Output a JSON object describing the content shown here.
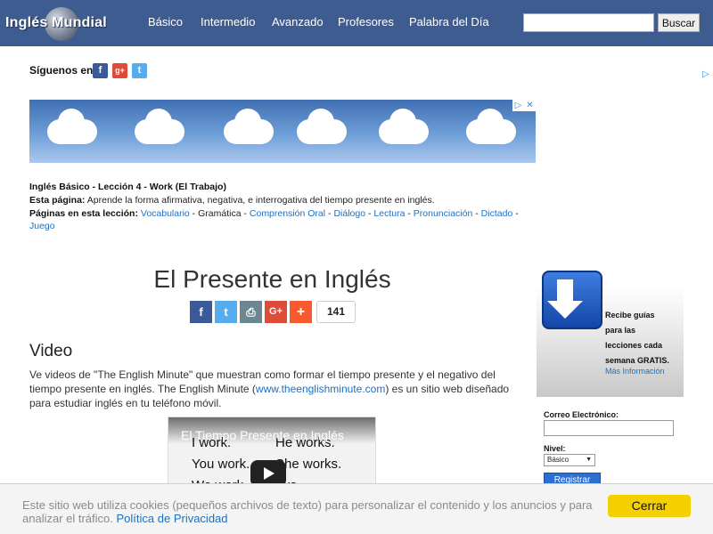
{
  "header": {
    "logo_text": "Inglés Mundial",
    "nav": [
      "Básico",
      "Intermedio",
      "Avanzado",
      "Profesores",
      "Palabra del Día"
    ],
    "search_placeholder": "",
    "search_button": "Buscar"
  },
  "social": {
    "follow_label": "Síguenos en",
    "facebook_glyph": "f",
    "google_glyph": "g+",
    "twitter_glyph": "t"
  },
  "ad": {
    "choices_glyph": "▷",
    "close_glyph": "✕",
    "side_marker": "▷"
  },
  "lesson": {
    "heading": "Inglés Básico - Lección 4 - Work (El Trabajo)",
    "page_label": "Esta página:",
    "page_desc": "Aprende la forma afirmativa, negativa, e interrogativa del tiempo presente en inglés.",
    "pages_label": "Páginas en esta lección:",
    "links": [
      {
        "text": "Vocabulario",
        "link": true
      },
      {
        "text": " - ",
        "link": false
      },
      {
        "text": "Gramática",
        "link": false
      },
      {
        "text": " - ",
        "link": false
      },
      {
        "text": "Comprensión Oral",
        "link": true
      },
      {
        "text": " - ",
        "link": false
      },
      {
        "text": "Diálogo",
        "link": true
      },
      {
        "text": " - ",
        "link": false
      },
      {
        "text": "Lectura",
        "link": true
      },
      {
        "text": " - ",
        "link": false
      },
      {
        "text": "Pronunciación",
        "link": true
      },
      {
        "text": " - ",
        "link": false
      },
      {
        "text": "Dictado",
        "link": true
      },
      {
        "text": " - ",
        "link": false
      }
    ],
    "last_link": "Juego"
  },
  "main": {
    "title": "El Presente en Inglés",
    "share": {
      "facebook": "f",
      "twitter": "t",
      "print": "⎙",
      "google": "G+",
      "more": "+",
      "count": "141"
    },
    "section_title": "Video",
    "para_before": "Ve videos de \"The English Minute\" que muestran como formar el tiempo presente y el negativo del tiempo presente en inglés. The English Minute (",
    "para_link": "www.theenglishminute.com",
    "para_after": ") es un sitio web diseñado para estudiar inglés en tu teléfono móvil.",
    "video": {
      "title": "El Tiempo Presente en Inglés",
      "line1a": "I work.",
      "line1b": "He works.",
      "line2a": "You work.",
      "line2b": "She works.",
      "line3": "We work.    It works."
    }
  },
  "sidebar": {
    "promo_lines": [
      "Recibe guías",
      "para las",
      "lecciones cada",
      "semana GRATIS."
    ],
    "more_info": "Más Información",
    "email_label": "Correo Electrónico:",
    "level_label": "Nivel:",
    "level_value": "Básico",
    "register_button": "Registrar"
  },
  "cookie": {
    "text": "Este sitio web utiliza cookies (pequeños archivos de texto) para personalizar el contenido y los anuncios y para analizar el tráfico. ",
    "link": "Política de Privacidad",
    "button": "Cerrar"
  },
  "colors": {
    "nav_bg": "#3f5c90",
    "link": "#1f6fbf",
    "facebook": "#3b5998",
    "twitter": "#55acee",
    "print": "#6d8790",
    "google": "#dd4b39",
    "more": "#f65a2d",
    "cookie_button": "#f5d000"
  }
}
